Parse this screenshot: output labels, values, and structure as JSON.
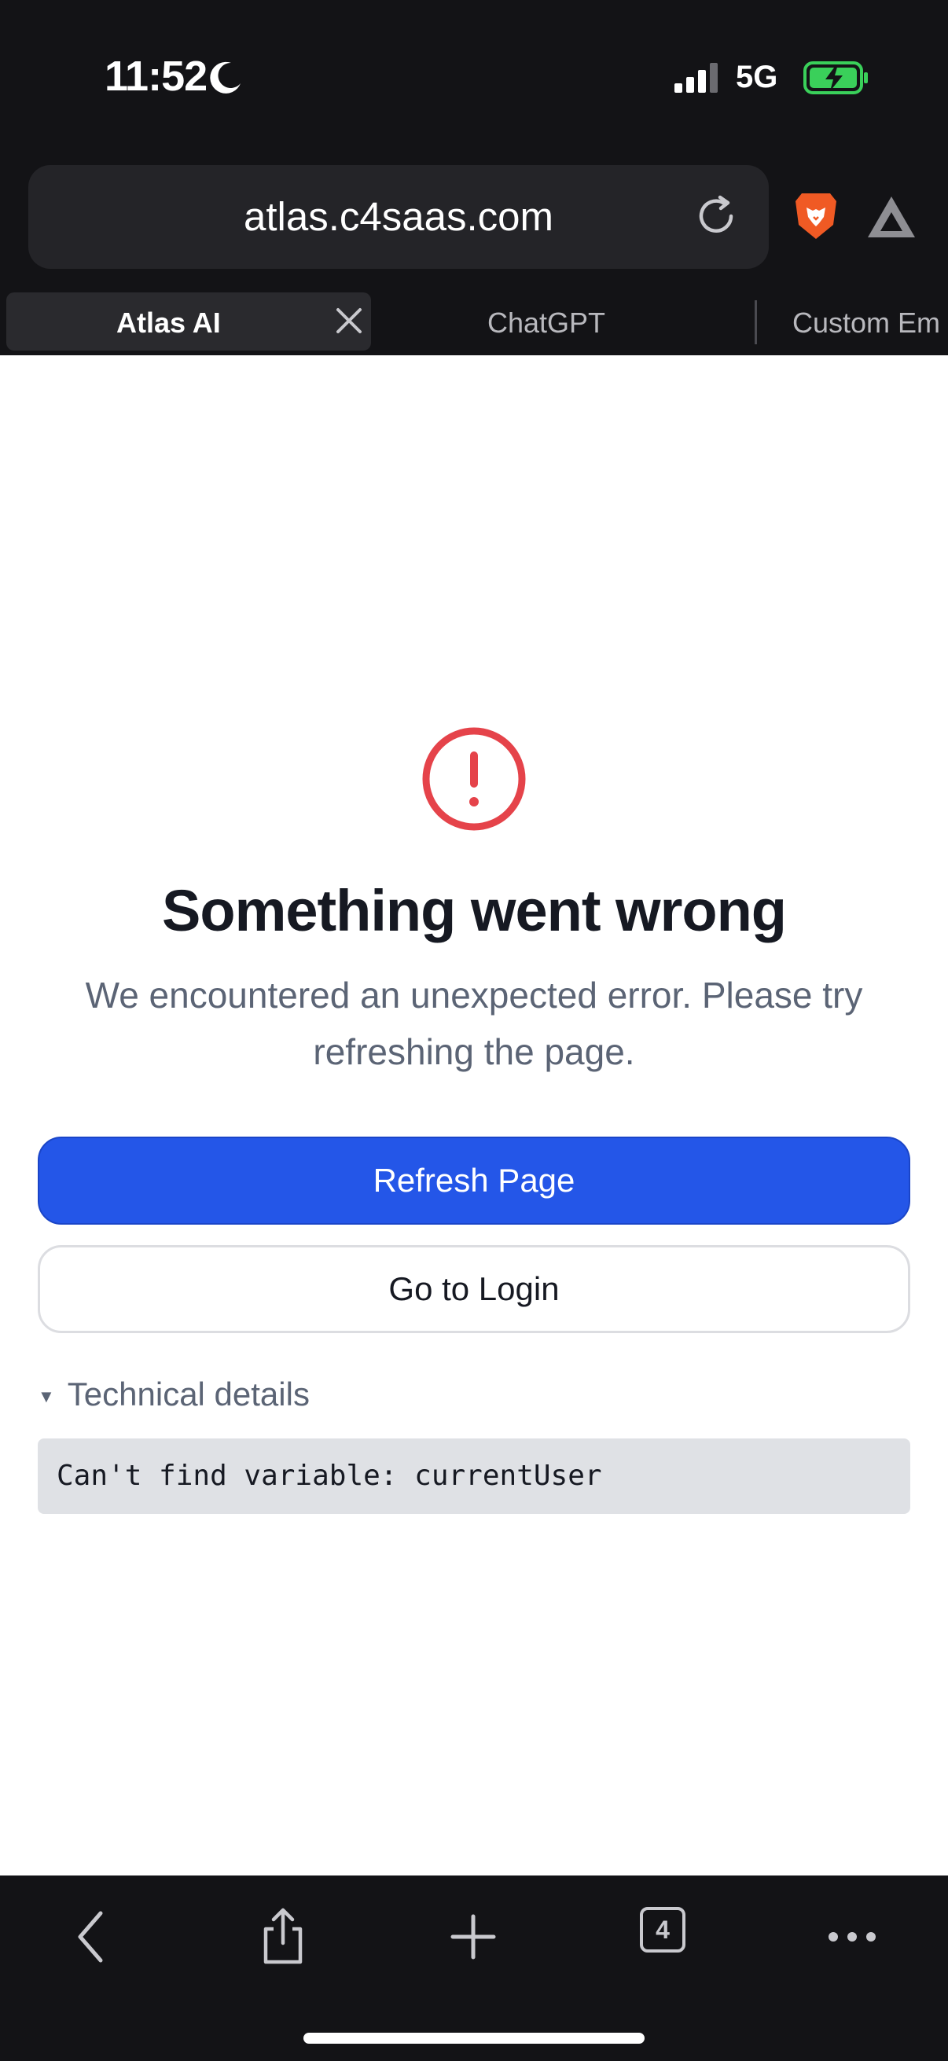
{
  "status_bar": {
    "time": "11:52",
    "network": "5G"
  },
  "browser": {
    "url": "atlas.c4saas.com",
    "tabs": [
      {
        "label": "Atlas AI",
        "active": true
      },
      {
        "label": "ChatGPT",
        "active": false
      },
      {
        "label": "Custom Em",
        "active": false
      }
    ],
    "tab_count": "4"
  },
  "error": {
    "title": "Something went wrong",
    "message": "We encountered an unexpected error. Please try refreshing the page.",
    "refresh_label": "Refresh Page",
    "login_label": "Go to Login",
    "details_label": "Technical details",
    "details_text": "Can't find variable: currentUser"
  },
  "colors": {
    "primary": "#2456e8",
    "error_red": "#e5434a",
    "chrome_bg": "#131316"
  }
}
